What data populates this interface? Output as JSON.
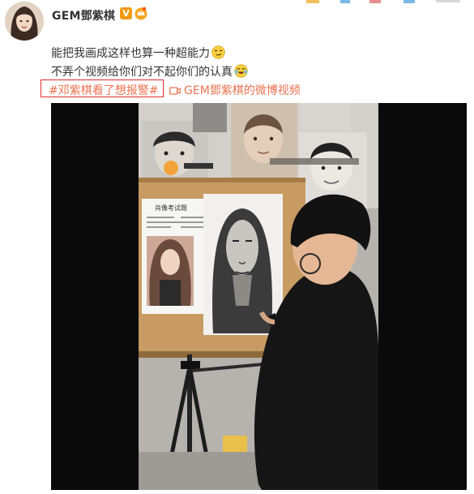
{
  "post": {
    "username": "GEM鄧紫棋",
    "verified_badge": "V",
    "lines": [
      "能把我画成这样也算一种超能力",
      "不弄个视频给你们对不起你们的认真"
    ],
    "emojis": [
      "smirk-emoji",
      "laugh-cry-emoji"
    ],
    "hashtag": "#邓紫棋看了想报警#",
    "video_link": "GEM鄧紫棋的微博视频"
  },
  "video": {
    "sheet_title": "肖像考试题"
  },
  "colors": {
    "link": "#eb7350",
    "highlight_border": "#d9302c",
    "verified": "#f29a12",
    "video_bg": "#0a0a0a"
  }
}
